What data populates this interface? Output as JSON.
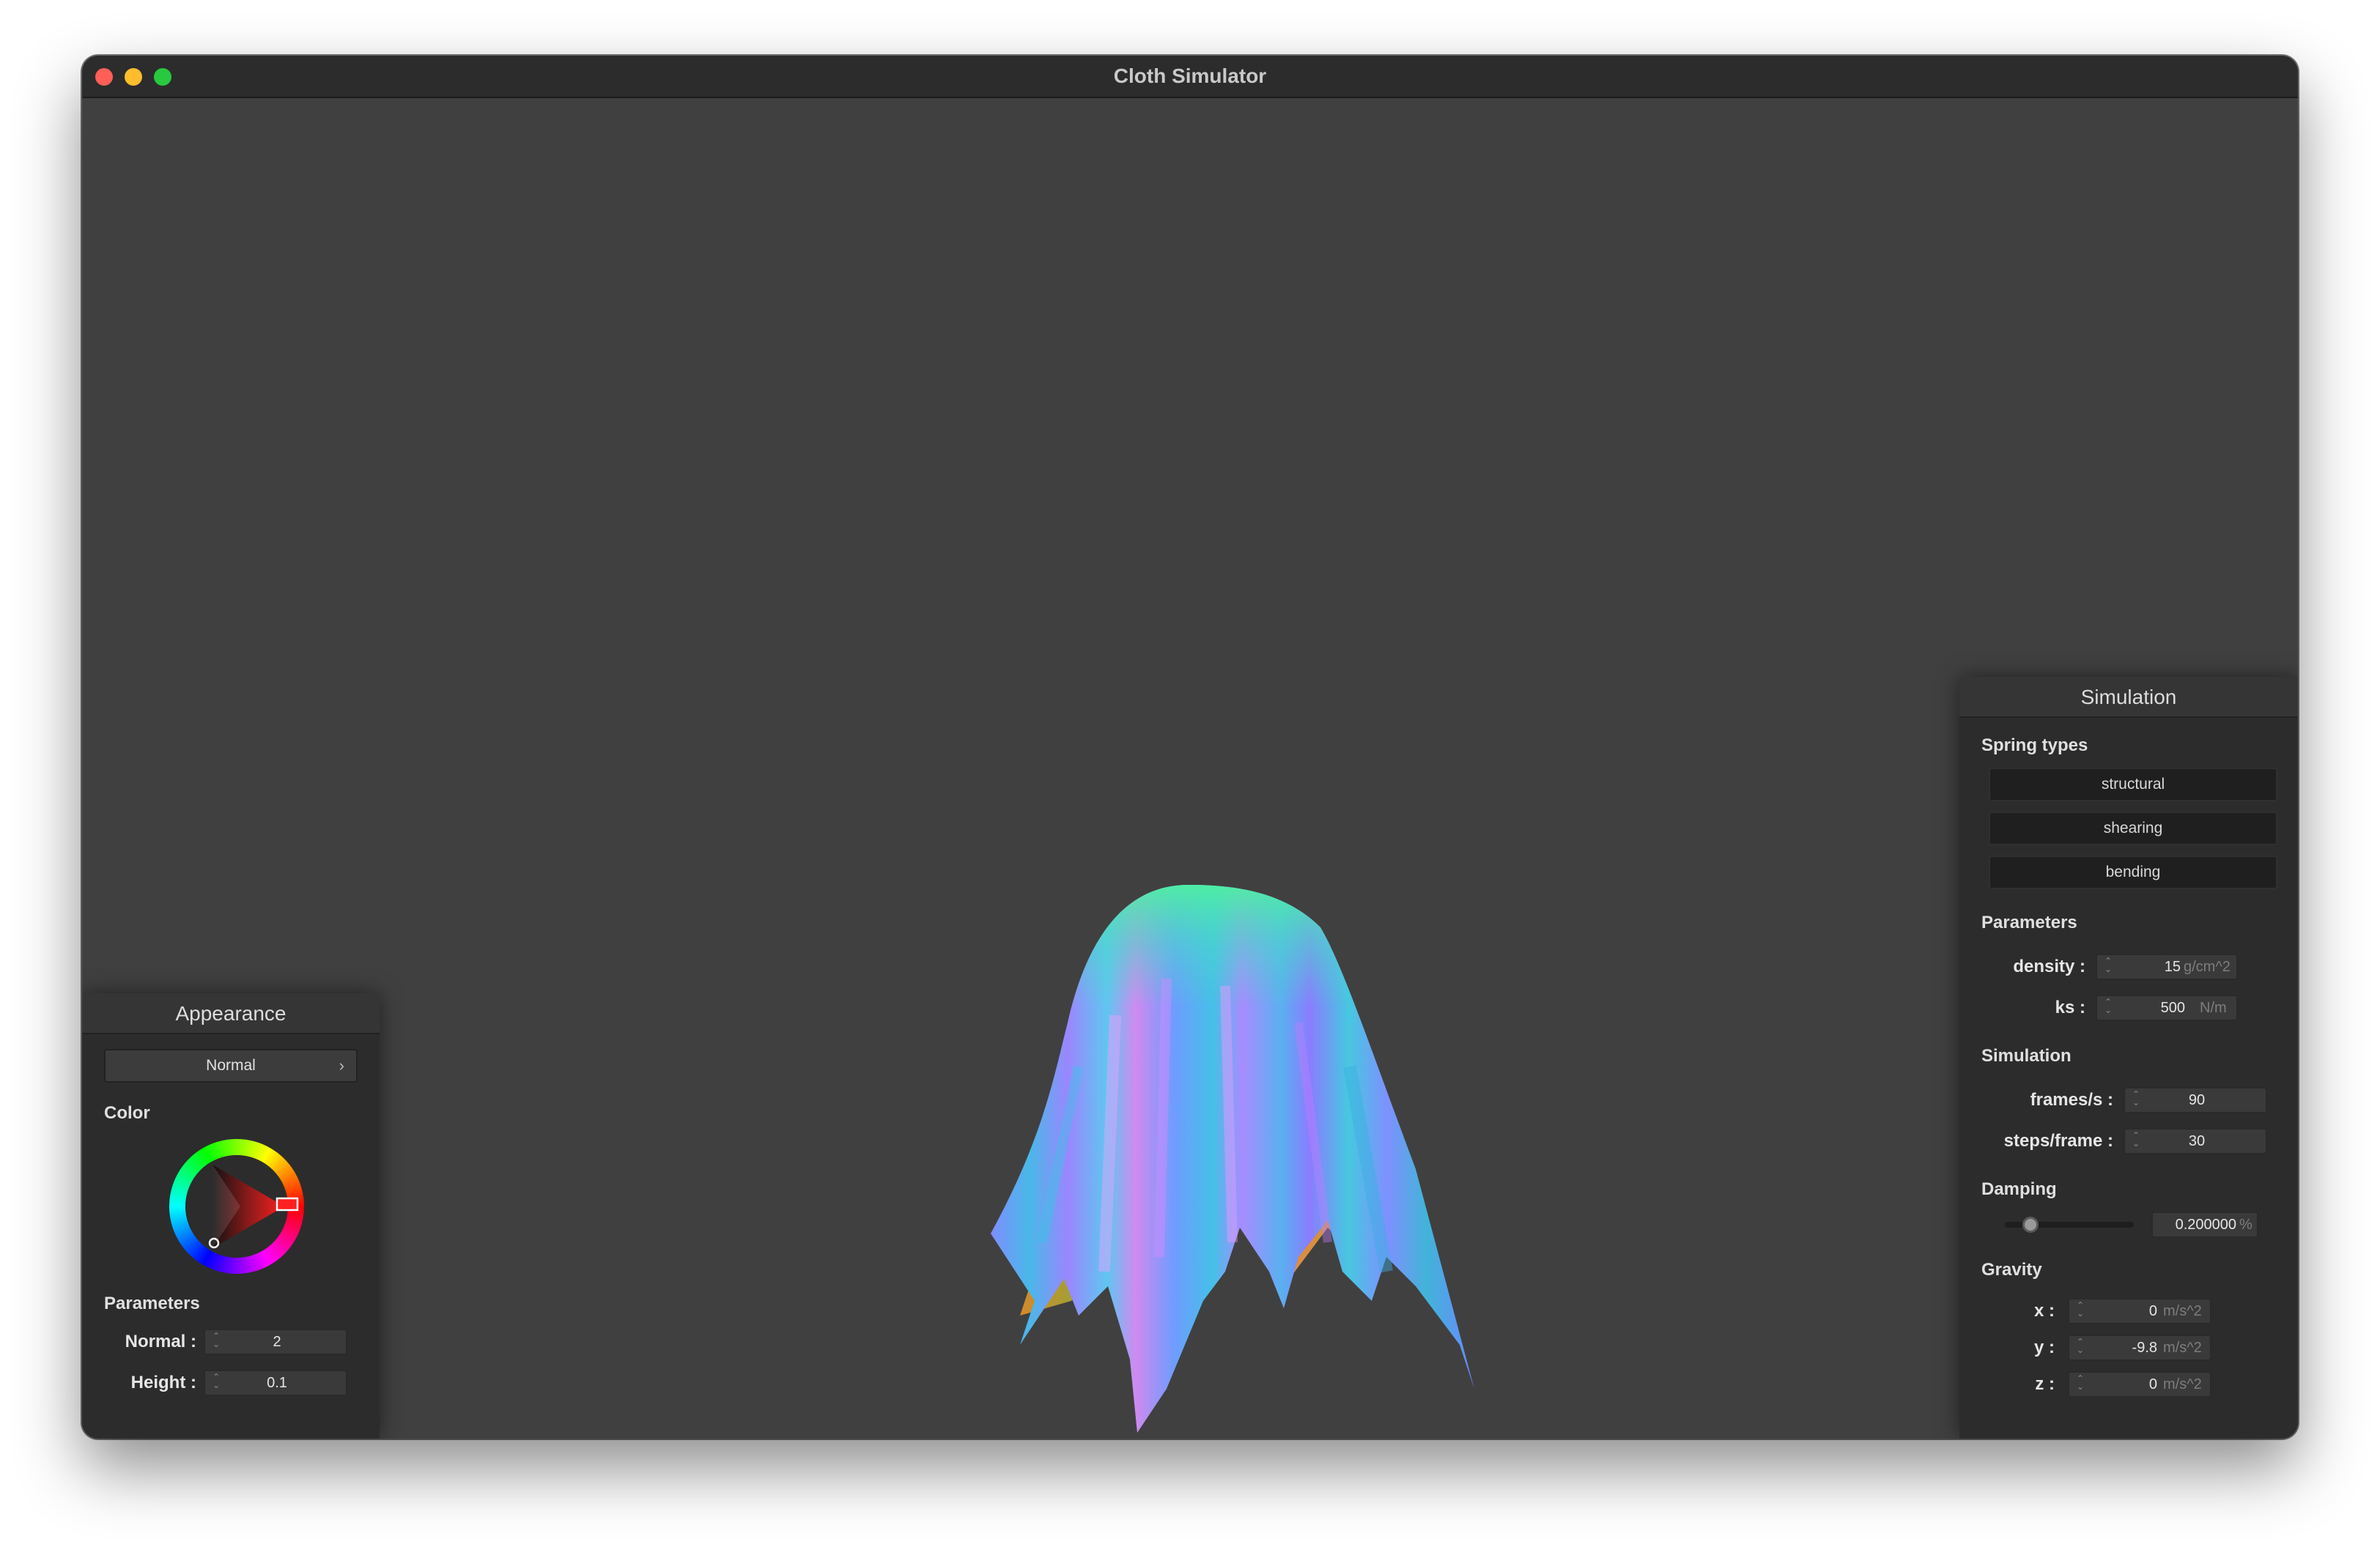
{
  "window": {
    "title": "Cloth Simulator"
  },
  "appearance_panel": {
    "title": "Appearance",
    "shader_dropdown": {
      "selected": "Normal"
    },
    "color_label": "Color",
    "parameters_label": "Parameters",
    "normal": {
      "label": "Normal :",
      "value": "2"
    },
    "height": {
      "label": "Height :",
      "value": "0.1"
    }
  },
  "simulation_panel": {
    "title": "Simulation",
    "spring_types_label": "Spring types",
    "spring_buttons": [
      "structural",
      "shearing",
      "bending"
    ],
    "parameters_label": "Parameters",
    "density": {
      "label": "density :",
      "value": "15",
      "unit": "g/cm^2"
    },
    "ks": {
      "label": "ks :",
      "value": "500",
      "unit": "N/m"
    },
    "simulation_label": "Simulation",
    "frames_per_s": {
      "label": "frames/s :",
      "value": "90"
    },
    "steps_per_frame": {
      "label": "steps/frame :",
      "value": "30"
    },
    "damping_label": "Damping",
    "damping": {
      "value": "0.200000",
      "unit": "%",
      "slider_fraction": 0.2
    },
    "gravity_label": "Gravity",
    "gravity_x": {
      "label": "x :",
      "value": "0",
      "unit": "m/s^2"
    },
    "gravity_y": {
      "label": "y :",
      "value": "-9.8",
      "unit": "m/s^2"
    },
    "gravity_z": {
      "label": "z :",
      "value": "0",
      "unit": "m/s^2"
    }
  },
  "colors": {
    "viewport_bg": "#404040",
    "panel_bg": "#2c2c2c",
    "selected_color": "#ff2020"
  }
}
